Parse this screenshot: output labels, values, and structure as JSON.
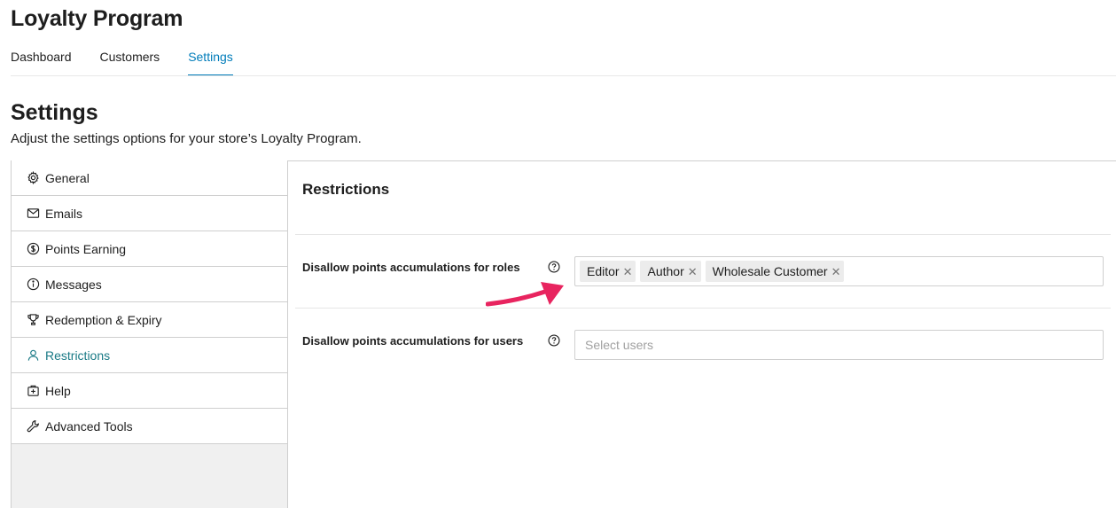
{
  "app": {
    "title": "Loyalty Program"
  },
  "top_tabs": [
    {
      "label": "Dashboard",
      "active": false
    },
    {
      "label": "Customers",
      "active": false
    },
    {
      "label": "Settings",
      "active": true
    }
  ],
  "page": {
    "title": "Settings",
    "subtitle": "Adjust the settings options for your store’s Loyalty Program."
  },
  "sidebar": {
    "items": [
      {
        "label": "General",
        "icon": "gear-icon",
        "active": false
      },
      {
        "label": "Emails",
        "icon": "envelope-icon",
        "active": false
      },
      {
        "label": "Points Earning",
        "icon": "dollar-coin-icon",
        "active": false
      },
      {
        "label": "Messages",
        "icon": "info-icon",
        "active": false
      },
      {
        "label": "Redemption & Expiry",
        "icon": "trophy-icon",
        "active": false
      },
      {
        "label": "Restrictions",
        "icon": "user-icon",
        "active": true
      },
      {
        "label": "Help",
        "icon": "help-box-icon",
        "active": false
      },
      {
        "label": "Advanced Tools",
        "icon": "wrench-icon",
        "active": false
      }
    ]
  },
  "restrictions": {
    "title": "Restrictions",
    "roles_label": "Disallow points accumulations for roles",
    "roles": [
      "Editor",
      "Author",
      "Wholesale Customer"
    ],
    "users_label": "Disallow points accumulations for users",
    "users_placeholder": "Select users"
  },
  "colors": {
    "accent": "#007cba",
    "active_sidebar": "#1a7a86",
    "arrow": "#e8245f"
  }
}
